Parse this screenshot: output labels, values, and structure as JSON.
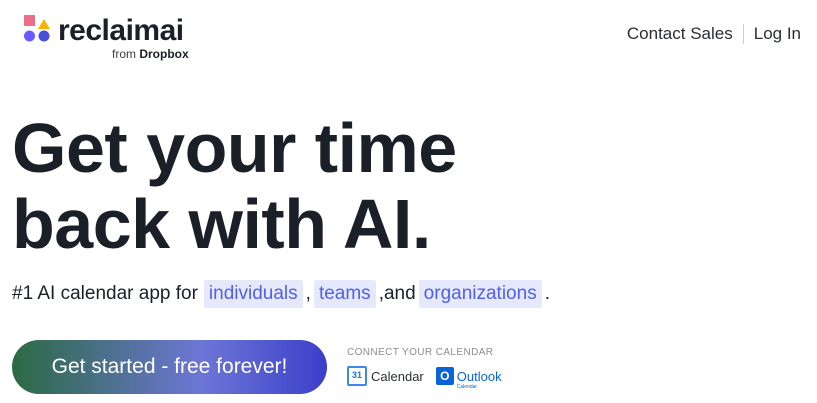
{
  "brand": {
    "wordmark": "reclaimai",
    "from_prefix": "from",
    "from_brand": "Dropbox",
    "colors": {
      "pink": "#e86f8a",
      "yellow": "#f4b400",
      "indigo": "#4a4fd8",
      "purple": "#9b6bff"
    }
  },
  "nav": {
    "contact_sales": "Contact Sales",
    "log_in": "Log In"
  },
  "hero": {
    "headline_line1": "Get your time",
    "headline_line2": "back with AI.",
    "tagline_prefix": "#1 AI calendar app for",
    "chip1": "individuals",
    "comma1": ",",
    "chip2": "teams",
    "and_text": ",and",
    "chip3": "organizations",
    "period": "."
  },
  "cta": {
    "label": "Get started - free forever!"
  },
  "connect": {
    "label": "CONNECT YOUR CALENDAR",
    "google_day": "31",
    "google_label": "Calendar",
    "outlook_letter": "O",
    "outlook_label": "Outlook",
    "outlook_sub": "Calendar"
  }
}
